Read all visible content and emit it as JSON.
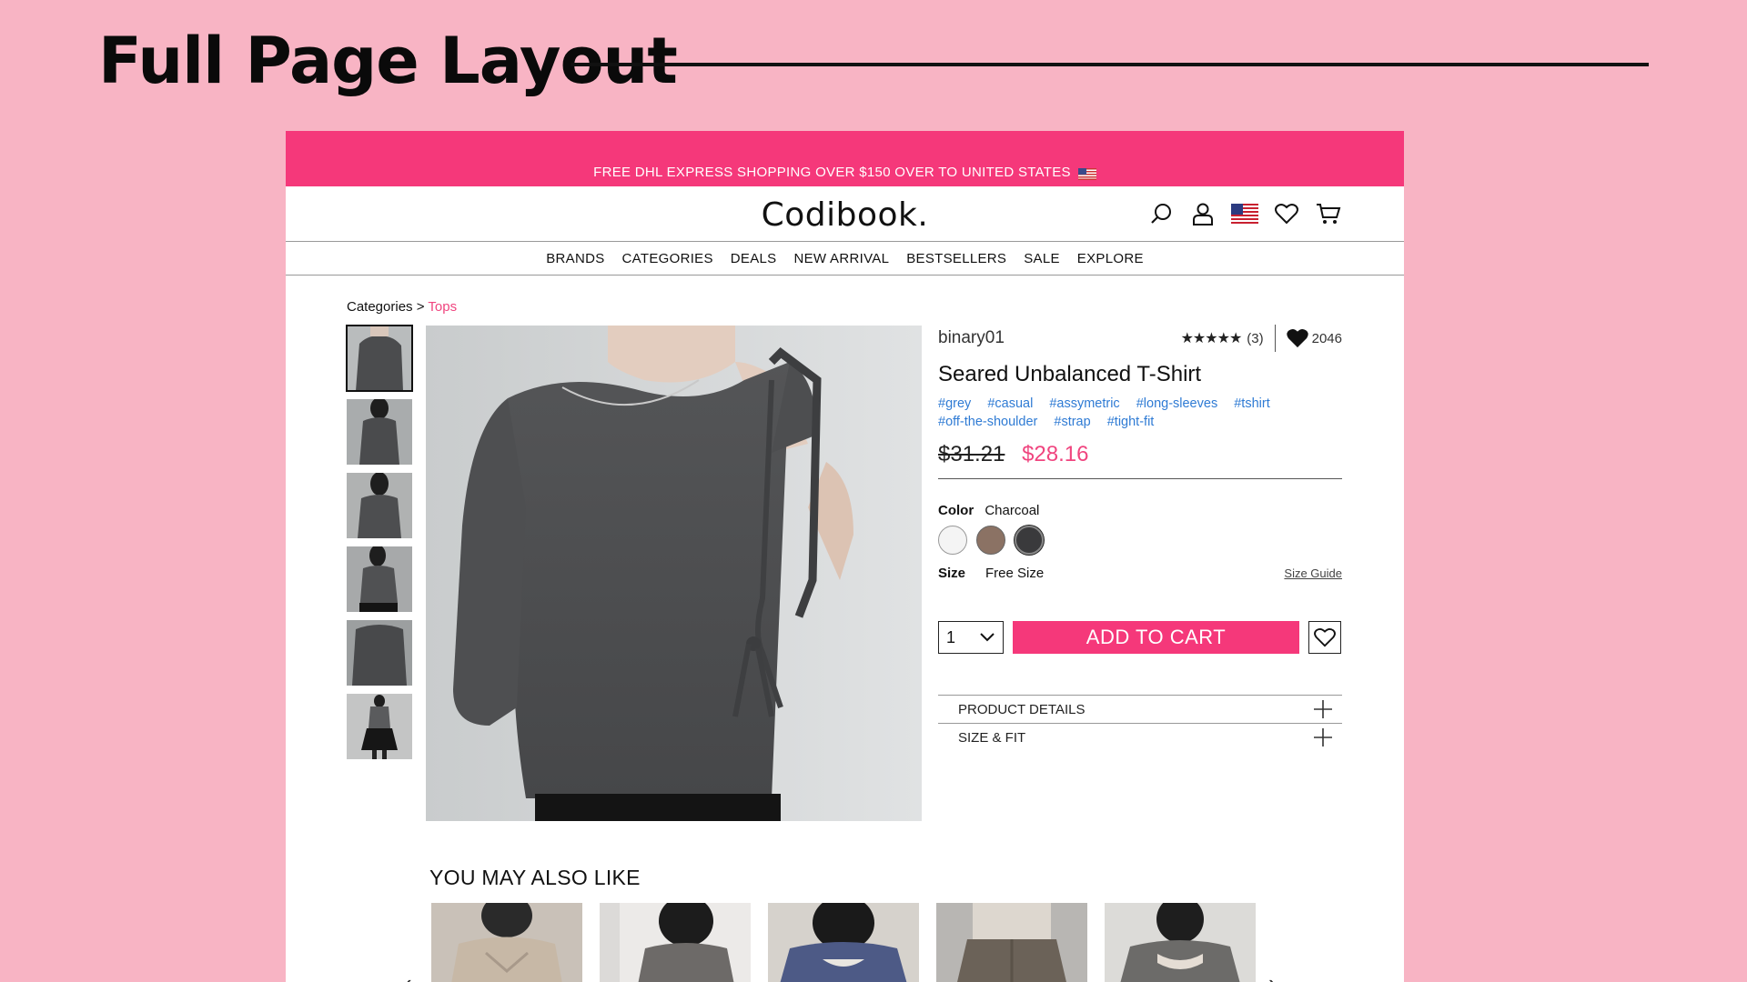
{
  "slide": {
    "title": "Full Page Layout"
  },
  "promo": {
    "text": "FREE DHL EXPRESS SHOPPING OVER $150 OVER TO UNITED STATES"
  },
  "header": {
    "logo": "Codibook.",
    "icons": [
      "search-icon",
      "user-icon",
      "us-flag-icon",
      "heart-icon",
      "cart-icon"
    ]
  },
  "nav": [
    "BRANDS",
    "CATEGORIES",
    "DEALS",
    "NEW ARRIVAL",
    "BESTSELLERS",
    "SALE",
    "EXPLORE"
  ],
  "breadcrumb": {
    "root": "Categories",
    "sep": ">",
    "current": "Tops"
  },
  "product": {
    "brand": "binary01",
    "stars": "★★★★★",
    "rating_value": 4.5,
    "review_count": "(3)",
    "likes": "2046",
    "name": "Seared Unbalanced T-Shirt",
    "tags": [
      "#grey",
      "#casual",
      "#assymetric",
      "#long-sleeves",
      "#tshirt",
      "#off-the-shoulder",
      "#strap",
      "#tight-fit"
    ],
    "old_price": "$31.21",
    "price": "$28.16",
    "color_label": "Color",
    "color_value": "Charcoal",
    "swatches": [
      "#f4f4f4",
      "#8b7264",
      "#3a3a3c"
    ],
    "selected_swatch": 2,
    "size_label": "Size",
    "size_value": "Free Size",
    "size_guide": "Size Guide",
    "qty": "1",
    "add_to_cart": "ADD TO CART",
    "accordion": [
      "PRODUCT DETAILS",
      "SIZE & FIT"
    ]
  },
  "recommendations": {
    "title": "YOU MAY ALSO LIKE"
  },
  "colors": {
    "accent": "#f5387a",
    "link": "#2f7bd4",
    "background": "#f8b4c4"
  }
}
